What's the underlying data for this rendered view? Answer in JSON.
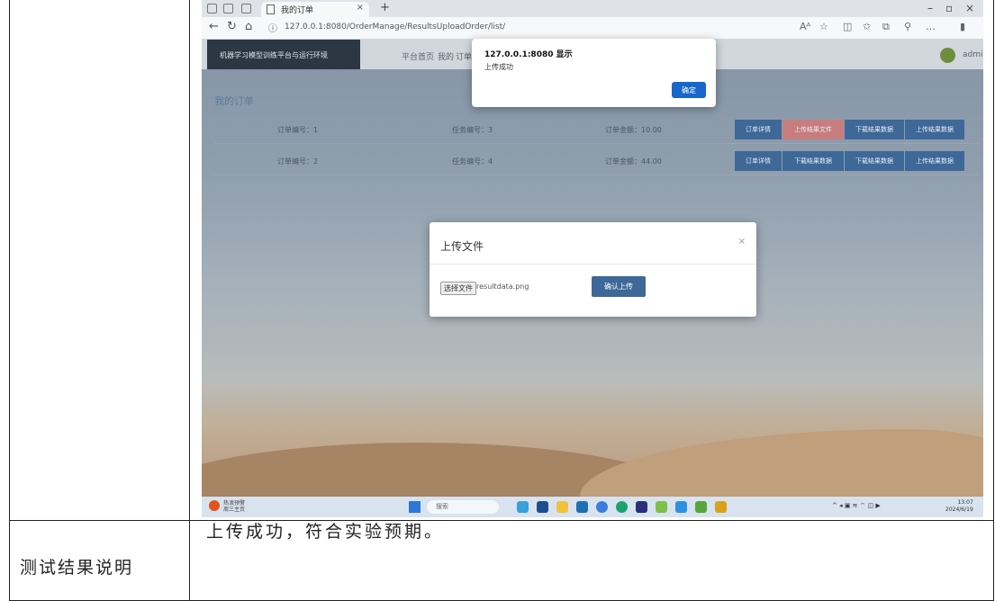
{
  "browser": {
    "tab_title": "我的订单",
    "url": "127.0.0.1:8080/OrderManage/ResultsUploadOrder/list/"
  },
  "app": {
    "brand": "机器学习模型训练平台与运行环境",
    "nav": [
      "平台首页",
      "我的",
      "订单"
    ],
    "user": "admin"
  },
  "section_title": "我的订单",
  "orders": [
    {
      "id_label": "订单编号：1",
      "task_label": "任务编号：3",
      "amount_label": "订单金额：10.00",
      "buttons": [
        "订单详情",
        "上传结果文件",
        "下载结果数据",
        "上传结果数据"
      ]
    },
    {
      "id_label": "订单编号：2",
      "task_label": "任务编号：4",
      "amount_label": "订单金额：44.00",
      "buttons": [
        "订单详情",
        "下载结果数据",
        "下载结果数据",
        "上传结果数据"
      ]
    }
  ],
  "upload_modal": {
    "title": "上传文件",
    "file_button": "选择文件",
    "file_name": "resultdata.png",
    "submit_label": "确认上传"
  },
  "alert": {
    "title": "127.0.0.1:8080 显示",
    "message": "上传成功",
    "ok_label": "确定"
  },
  "taskbar": {
    "weather": "热浪预警",
    "weather_sub": "周三主页",
    "search": "搜索",
    "time": "13:07",
    "date": "2024/6/19"
  },
  "doc": {
    "label": "测试结果说明",
    "text": "上传成功，符合实验预期。"
  },
  "colors": {
    "primary_button": "#3d6898",
    "danger_button": "#c77d7d",
    "alert_ok": "#1667c9",
    "nav_dark": "#2d3743"
  }
}
